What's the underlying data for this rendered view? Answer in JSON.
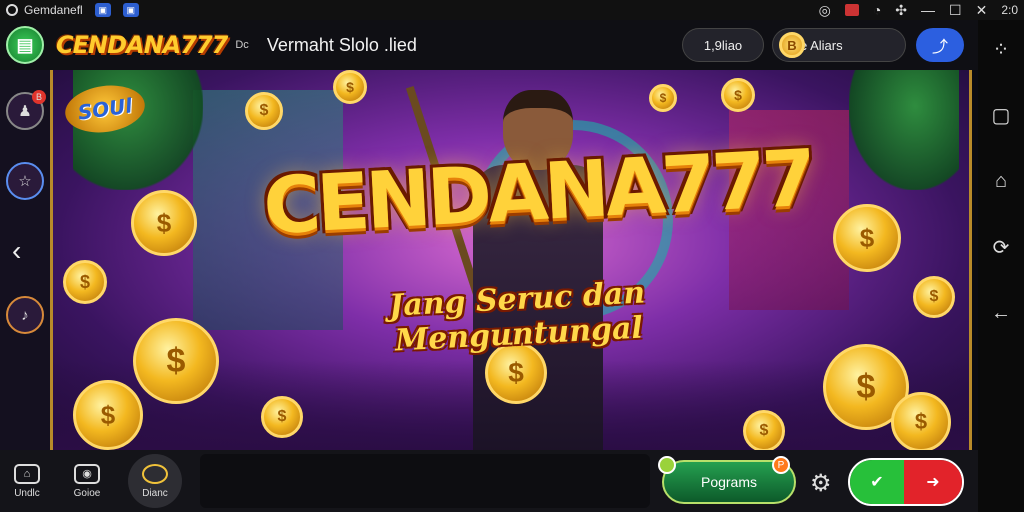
{
  "status_bar": {
    "app_name": "Gemdanefl",
    "right_icons": [
      "google-icon",
      "gallery-icon",
      "photos-icon",
      "wifi-icon",
      "minimize-icon",
      "maximize-icon",
      "close-icon"
    ],
    "right_text": "2:0"
  },
  "header": {
    "brand": "CENDANA777",
    "brand_suffix": "Dc",
    "title": "Vermaht Slolo .lied",
    "balance": "1,9liao",
    "login_label": "Inlae Aliars",
    "login_coin": "B"
  },
  "left_rail": {
    "badge_count": "B"
  },
  "banner": {
    "soul_badge": "SOUl",
    "title": "CENDANA777",
    "tagline": "Jang Seruc dan Menguntungal",
    "coin_symbol": "$"
  },
  "bottom_bar": {
    "tabs": [
      {
        "label": "Undlc",
        "icon": "shop-icon"
      },
      {
        "label": "Goioe",
        "icon": "game-icon"
      },
      {
        "label": "Dianc",
        "icon": "home-icon"
      }
    ],
    "program_label": "Pograms",
    "program_badge": "P"
  },
  "colors": {
    "accent_gold": "#ffd23a",
    "toggle_on": "#27c03a",
    "toggle_off": "#e2232a",
    "share_blue": "#2c5fe0"
  }
}
